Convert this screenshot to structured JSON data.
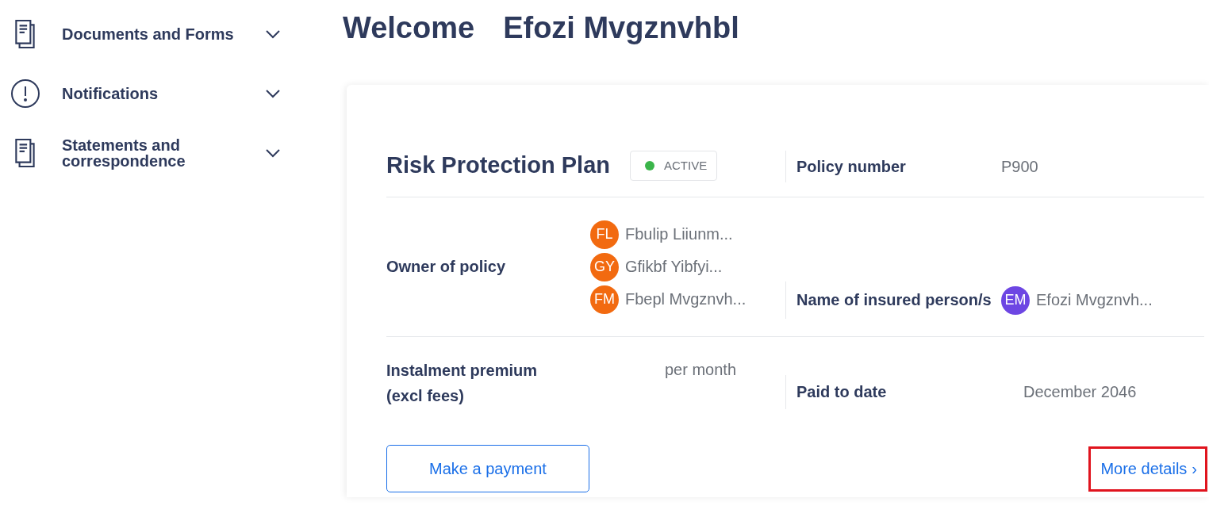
{
  "sidebar": {
    "items": [
      {
        "label": "Documents and Forms",
        "kind": "document",
        "expanded": false
      },
      {
        "label": "Notifications",
        "kind": "alert",
        "expanded": false
      },
      {
        "label": "Statements and correspondence",
        "kind": "document",
        "expanded": false
      }
    ]
  },
  "header": {
    "greeting": "Welcome",
    "user_name": "Efozi Mvgznvhbl"
  },
  "policy_card": {
    "title": "Risk Protection Plan",
    "status": {
      "label": "ACTIVE",
      "color": "#3bb54a"
    },
    "policy_number": {
      "label": "Policy number",
      "value": "P900"
    },
    "owners": {
      "label": "Owner of policy",
      "people": [
        {
          "initials": "FL",
          "name": "Fbulip Liiunm...",
          "color": "#f26a10"
        },
        {
          "initials": "GY",
          "name": "Gfikbf Yibfyi...",
          "color": "#f26a10"
        },
        {
          "initials": "FM",
          "name": "Fbepl Mvgznvh...",
          "color": "#f26a10"
        }
      ]
    },
    "insured": {
      "label": "Name of insured person/s",
      "people": [
        {
          "initials": "EM",
          "name": "Efozi Mvgznvh...",
          "color": "#6d46e3"
        }
      ]
    },
    "premium": {
      "label": "Instalment premium (excl fees)",
      "value": "per month"
    },
    "paid_to_date": {
      "label": "Paid to date",
      "value": "December 2046"
    },
    "payment_button": "Make a payment",
    "more_details": {
      "label": "More details",
      "chevron": "›",
      "highlighted": true
    }
  }
}
